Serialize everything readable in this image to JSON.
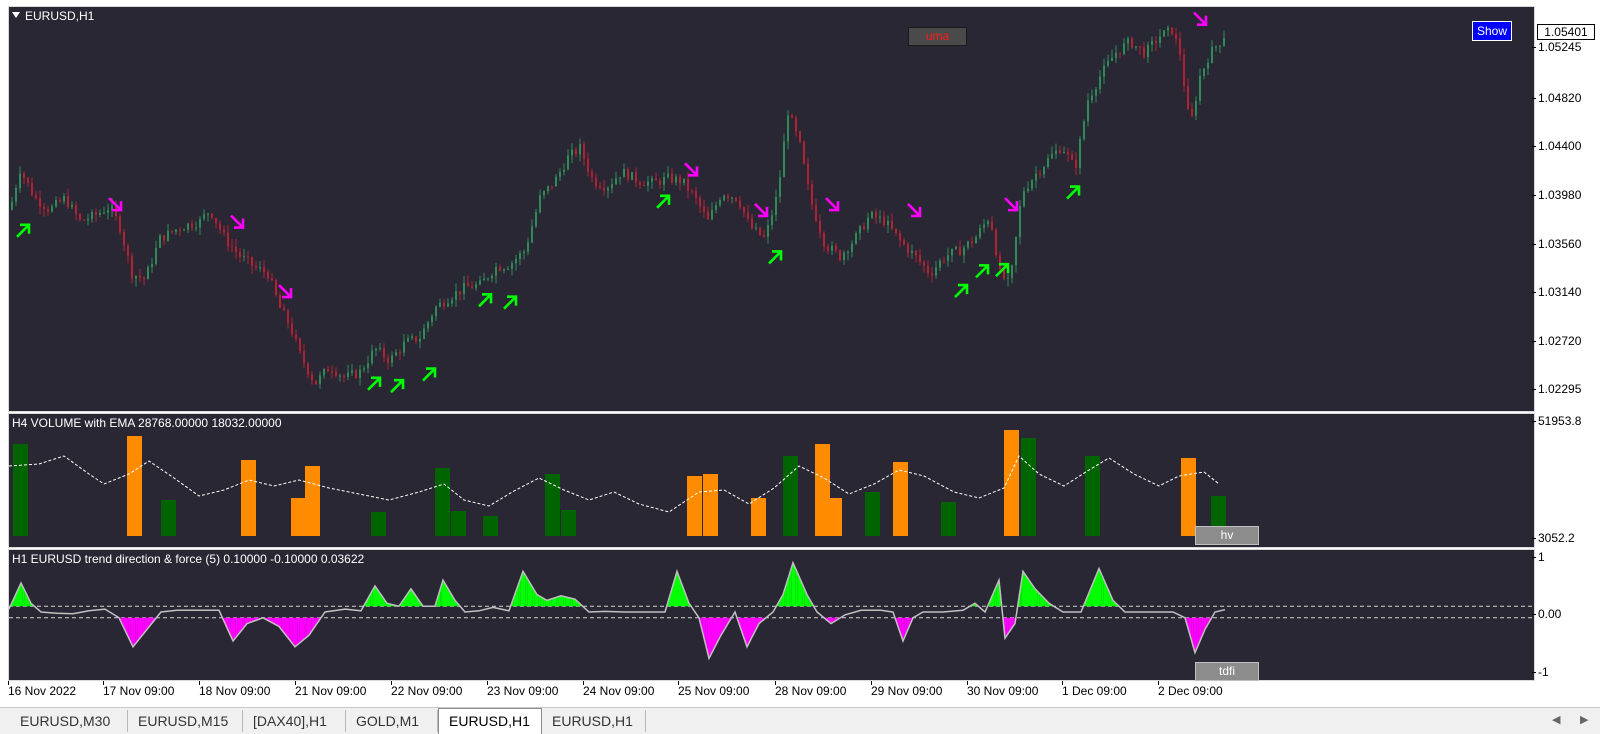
{
  "symbol": "EURUSD,H1",
  "buttons": {
    "uma": "uma",
    "show": "Show",
    "hv": "hv",
    "tdfi": "tdfi"
  },
  "main_pane": {
    "title": "EURUSD,H1",
    "current_price": "1.05401",
    "price_ticks": [
      "1.05245",
      "1.04820",
      "1.04400",
      "1.03980",
      "1.03560",
      "1.03140",
      "1.02720",
      "1.02295"
    ]
  },
  "volume_pane": {
    "title": "H4 VOLUME with EMA 28768.00000 18032.00000",
    "ticks": [
      "51953.8",
      "3052.2"
    ],
    "colors": {
      "high": "#ff8c00",
      "low": "#006400",
      "ema": "#ffffff"
    }
  },
  "tdf_pane": {
    "title": "H1 EURUSD trend direction & force (5) 0.10000 -0.10000 0.03622",
    "ticks": [
      "1",
      "0.00",
      "-1"
    ],
    "colors": {
      "up": "#00ff00",
      "down": "#ff00ff",
      "line": "#c0c0c0"
    }
  },
  "time_labels": [
    "16 Nov 2022",
    "17 Nov 09:00",
    "18 Nov 09:00",
    "21 Nov 09:00",
    "22 Nov 09:00",
    "23 Nov 09:00",
    "24 Nov 09:00",
    "25 Nov 09:00",
    "28 Nov 09:00",
    "29 Nov 09:00",
    "30 Nov 09:00",
    "1 Dec 09:00",
    "2 Dec 09:00"
  ],
  "tabs": [
    {
      "label": "EURUSD,M30",
      "active": false
    },
    {
      "label": "EURUSD,M15",
      "active": false
    },
    {
      "label": "[DAX40],H1",
      "active": false
    },
    {
      "label": "GOLD,M1",
      "active": false
    },
    {
      "label": "EURUSD,H1",
      "active": true
    },
    {
      "label": "EURUSD,H1",
      "active": false
    }
  ],
  "candle_colors": {
    "bull": "#2e8b57",
    "bear": "#b22234"
  },
  "price_path": [
    [
      0,
      1.0385
    ],
    [
      10,
      1.042
    ],
    [
      25,
      1.0395
    ],
    [
      40,
      1.0385
    ],
    [
      55,
      1.0395
    ],
    [
      70,
      1.0375
    ],
    [
      85,
      1.038
    ],
    [
      100,
      1.0388
    ],
    [
      110,
      1.037
    ],
    [
      122,
      1.033
    ],
    [
      135,
      1.0325
    ],
    [
      150,
      1.036
    ],
    [
      170,
      1.037
    ],
    [
      190,
      1.0375
    ],
    [
      200,
      1.0385
    ],
    [
      215,
      1.036
    ],
    [
      230,
      1.0345
    ],
    [
      245,
      1.0335
    ],
    [
      258,
      1.033
    ],
    [
      270,
      1.03
    ],
    [
      280,
      1.0285
    ],
    [
      290,
      1.026
    ],
    [
      305,
      1.0235
    ],
    [
      320,
      1.025
    ],
    [
      335,
      1.024
    ],
    [
      350,
      1.0245
    ],
    [
      365,
      1.0265
    ],
    [
      380,
      1.0255
    ],
    [
      395,
      1.027
    ],
    [
      410,
      1.0275
    ],
    [
      425,
      1.03
    ],
    [
      440,
      1.031
    ],
    [
      455,
      1.0318
    ],
    [
      470,
      1.032
    ],
    [
      485,
      1.0335
    ],
    [
      500,
      1.0338
    ],
    [
      515,
      1.035
    ],
    [
      530,
      1.0395
    ],
    [
      545,
      1.041
    ],
    [
      558,
      1.043
    ],
    [
      570,
      1.0438
    ],
    [
      583,
      1.041
    ],
    [
      597,
      1.0405
    ],
    [
      612,
      1.0418
    ],
    [
      628,
      1.041
    ],
    [
      643,
      1.0408
    ],
    [
      658,
      1.0412
    ],
    [
      672,
      1.041
    ],
    [
      685,
      1.0395
    ],
    [
      698,
      1.0375
    ],
    [
      712,
      1.04
    ],
    [
      728,
      1.0395
    ],
    [
      740,
      1.037
    ],
    [
      755,
      1.036
    ],
    [
      768,
      1.04
    ],
    [
      778,
      1.047
    ],
    [
      790,
      1.044
    ],
    [
      800,
      1.0395
    ],
    [
      815,
      1.0355
    ],
    [
      830,
      1.0345
    ],
    [
      845,
      1.036
    ],
    [
      860,
      1.038
    ],
    [
      875,
      1.0375
    ],
    [
      890,
      1.0358
    ],
    [
      905,
      1.0345
    ],
    [
      920,
      1.033
    ],
    [
      935,
      1.0345
    ],
    [
      950,
      1.035
    ],
    [
      965,
      1.036
    ],
    [
      980,
      1.038
    ],
    [
      990,
      1.033
    ],
    [
      1000,
      1.032
    ],
    [
      1012,
      1.04
    ],
    [
      1025,
      1.0415
    ],
    [
      1040,
      1.043
    ],
    [
      1052,
      1.044
    ],
    [
      1065,
      1.042
    ],
    [
      1078,
      1.048
    ],
    [
      1090,
      1.05
    ],
    [
      1105,
      1.052
    ],
    [
      1120,
      1.053
    ],
    [
      1135,
      1.052
    ],
    [
      1150,
      1.0535
    ],
    [
      1162,
      1.054
    ],
    [
      1170,
      1.052
    ],
    [
      1180,
      1.0455
    ],
    [
      1190,
      1.05
    ],
    [
      1200,
      1.052
    ],
    [
      1210,
      1.053
    ],
    [
      1216,
      1.0538
    ]
  ],
  "up_arrows": [
    [
      8,
      1.0372
    ],
    [
      359,
      1.024
    ],
    [
      382,
      1.0238
    ],
    [
      414,
      1.0248
    ],
    [
      470,
      1.0312
    ],
    [
      495,
      1.031
    ],
    [
      648,
      1.0397
    ],
    [
      760,
      1.0349
    ],
    [
      946,
      1.032
    ],
    [
      967,
      1.0337
    ],
    [
      987,
      1.0338
    ],
    [
      1058,
      1.0405
    ]
  ],
  "down_arrows": [
    [
      100,
      1.0395
    ],
    [
      222,
      1.038
    ],
    [
      270,
      1.032
    ],
    [
      676,
      1.0425
    ],
    [
      746,
      1.039
    ],
    [
      817,
      1.0395
    ],
    [
      899,
      1.039
    ],
    [
      996,
      1.0395
    ],
    [
      1185,
      1.0555
    ]
  ],
  "volume_bars": [
    [
      4,
      0.92,
      "low"
    ],
    [
      118,
      1.0,
      "high"
    ],
    [
      152,
      0.36,
      "low"
    ],
    [
      232,
      0.76,
      "high"
    ],
    [
      282,
      0.38,
      "high"
    ],
    [
      296,
      0.7,
      "high"
    ],
    [
      362,
      0.24,
      "low"
    ],
    [
      426,
      0.68,
      "low"
    ],
    [
      442,
      0.25,
      "low"
    ],
    [
      474,
      0.2,
      "low"
    ],
    [
      536,
      0.62,
      "low"
    ],
    [
      552,
      0.26,
      "low"
    ],
    [
      678,
      0.6,
      "high"
    ],
    [
      694,
      0.62,
      "high"
    ],
    [
      742,
      0.38,
      "high"
    ],
    [
      774,
      0.8,
      "low"
    ],
    [
      806,
      0.92,
      "high"
    ],
    [
      818,
      0.38,
      "high"
    ],
    [
      856,
      0.44,
      "low"
    ],
    [
      884,
      0.74,
      "high"
    ],
    [
      932,
      0.34,
      "low"
    ],
    [
      995,
      1.06,
      "high"
    ],
    [
      1012,
      0.98,
      "low"
    ],
    [
      1076,
      0.8,
      "low"
    ],
    [
      1172,
      0.78,
      "high"
    ],
    [
      1202,
      0.4,
      "low"
    ]
  ],
  "volume_ema": [
    [
      0,
      0.7
    ],
    [
      30,
      0.72
    ],
    [
      55,
      0.8
    ],
    [
      80,
      0.62
    ],
    [
      95,
      0.52
    ],
    [
      120,
      0.62
    ],
    [
      140,
      0.75
    ],
    [
      165,
      0.58
    ],
    [
      190,
      0.4
    ],
    [
      215,
      0.46
    ],
    [
      240,
      0.56
    ],
    [
      265,
      0.5
    ],
    [
      290,
      0.56
    ],
    [
      320,
      0.48
    ],
    [
      350,
      0.42
    ],
    [
      380,
      0.36
    ],
    [
      410,
      0.44
    ],
    [
      435,
      0.52
    ],
    [
      455,
      0.36
    ],
    [
      480,
      0.3
    ],
    [
      505,
      0.45
    ],
    [
      530,
      0.58
    ],
    [
      555,
      0.46
    ],
    [
      580,
      0.36
    ],
    [
      605,
      0.44
    ],
    [
      630,
      0.32
    ],
    [
      660,
      0.24
    ],
    [
      690,
      0.44
    ],
    [
      715,
      0.46
    ],
    [
      740,
      0.32
    ],
    [
      765,
      0.48
    ],
    [
      790,
      0.7
    ],
    [
      815,
      0.58
    ],
    [
      840,
      0.42
    ],
    [
      865,
      0.52
    ],
    [
      890,
      0.66
    ],
    [
      915,
      0.6
    ],
    [
      945,
      0.44
    ],
    [
      970,
      0.38
    ],
    [
      995,
      0.48
    ],
    [
      1010,
      0.8
    ],
    [
      1030,
      0.62
    ],
    [
      1055,
      0.5
    ],
    [
      1080,
      0.66
    ],
    [
      1100,
      0.78
    ],
    [
      1125,
      0.62
    ],
    [
      1150,
      0.5
    ],
    [
      1170,
      0.6
    ],
    [
      1195,
      0.64
    ],
    [
      1210,
      0.52
    ]
  ],
  "tdf_line": [
    [
      0,
      0.05
    ],
    [
      12,
      0.5
    ],
    [
      22,
      0.15
    ],
    [
      32,
      0.0
    ],
    [
      48,
      -0.02
    ],
    [
      64,
      -0.03
    ],
    [
      80,
      0.02
    ],
    [
      96,
      0.05
    ],
    [
      110,
      -0.1
    ],
    [
      124,
      -0.6
    ],
    [
      138,
      -0.3
    ],
    [
      152,
      0.0
    ],
    [
      168,
      0.03
    ],
    [
      188,
      0.03
    ],
    [
      210,
      0.03
    ],
    [
      224,
      -0.5
    ],
    [
      238,
      -0.2
    ],
    [
      254,
      -0.1
    ],
    [
      270,
      -0.25
    ],
    [
      286,
      -0.6
    ],
    [
      300,
      -0.4
    ],
    [
      316,
      0.0
    ],
    [
      336,
      0.05
    ],
    [
      352,
      0.02
    ],
    [
      366,
      0.45
    ],
    [
      378,
      0.15
    ],
    [
      390,
      0.1
    ],
    [
      402,
      0.4
    ],
    [
      414,
      0.1
    ],
    [
      426,
      0.1
    ],
    [
      434,
      0.55
    ],
    [
      446,
      0.2
    ],
    [
      456,
      0.0
    ],
    [
      470,
      0.02
    ],
    [
      484,
      0.08
    ],
    [
      500,
      0.02
    ],
    [
      514,
      0.7
    ],
    [
      528,
      0.3
    ],
    [
      538,
      0.2
    ],
    [
      552,
      0.28
    ],
    [
      566,
      0.22
    ],
    [
      580,
      0.0
    ],
    [
      596,
      0.01
    ],
    [
      616,
      0.0
    ],
    [
      640,
      0.0
    ],
    [
      656,
      0.0
    ],
    [
      668,
      0.7
    ],
    [
      680,
      0.15
    ],
    [
      690,
      -0.1
    ],
    [
      700,
      -0.8
    ],
    [
      712,
      -0.4
    ],
    [
      726,
      0.0
    ],
    [
      738,
      -0.6
    ],
    [
      750,
      -0.2
    ],
    [
      764,
      0.0
    ],
    [
      774,
      0.3
    ],
    [
      784,
      0.85
    ],
    [
      798,
      0.3
    ],
    [
      808,
      0.0
    ],
    [
      822,
      -0.2
    ],
    [
      836,
      -0.05
    ],
    [
      852,
      0.03
    ],
    [
      872,
      0.03
    ],
    [
      884,
      0.0
    ],
    [
      894,
      -0.5
    ],
    [
      904,
      -0.1
    ],
    [
      914,
      0.0
    ],
    [
      934,
      0.0
    ],
    [
      954,
      0.03
    ],
    [
      966,
      0.15
    ],
    [
      976,
      0.0
    ],
    [
      990,
      0.55
    ],
    [
      996,
      -0.45
    ],
    [
      1006,
      -0.2
    ],
    [
      1014,
      0.7
    ],
    [
      1026,
      0.4
    ],
    [
      1040,
      0.15
    ],
    [
      1054,
      0.0
    ],
    [
      1072,
      0.0
    ],
    [
      1090,
      0.75
    ],
    [
      1104,
      0.2
    ],
    [
      1116,
      0.0
    ],
    [
      1140,
      0.0
    ],
    [
      1164,
      0.0
    ],
    [
      1176,
      -0.1
    ],
    [
      1186,
      -0.7
    ],
    [
      1196,
      -0.3
    ],
    [
      1206,
      0.0
    ],
    [
      1216,
      0.04
    ]
  ]
}
